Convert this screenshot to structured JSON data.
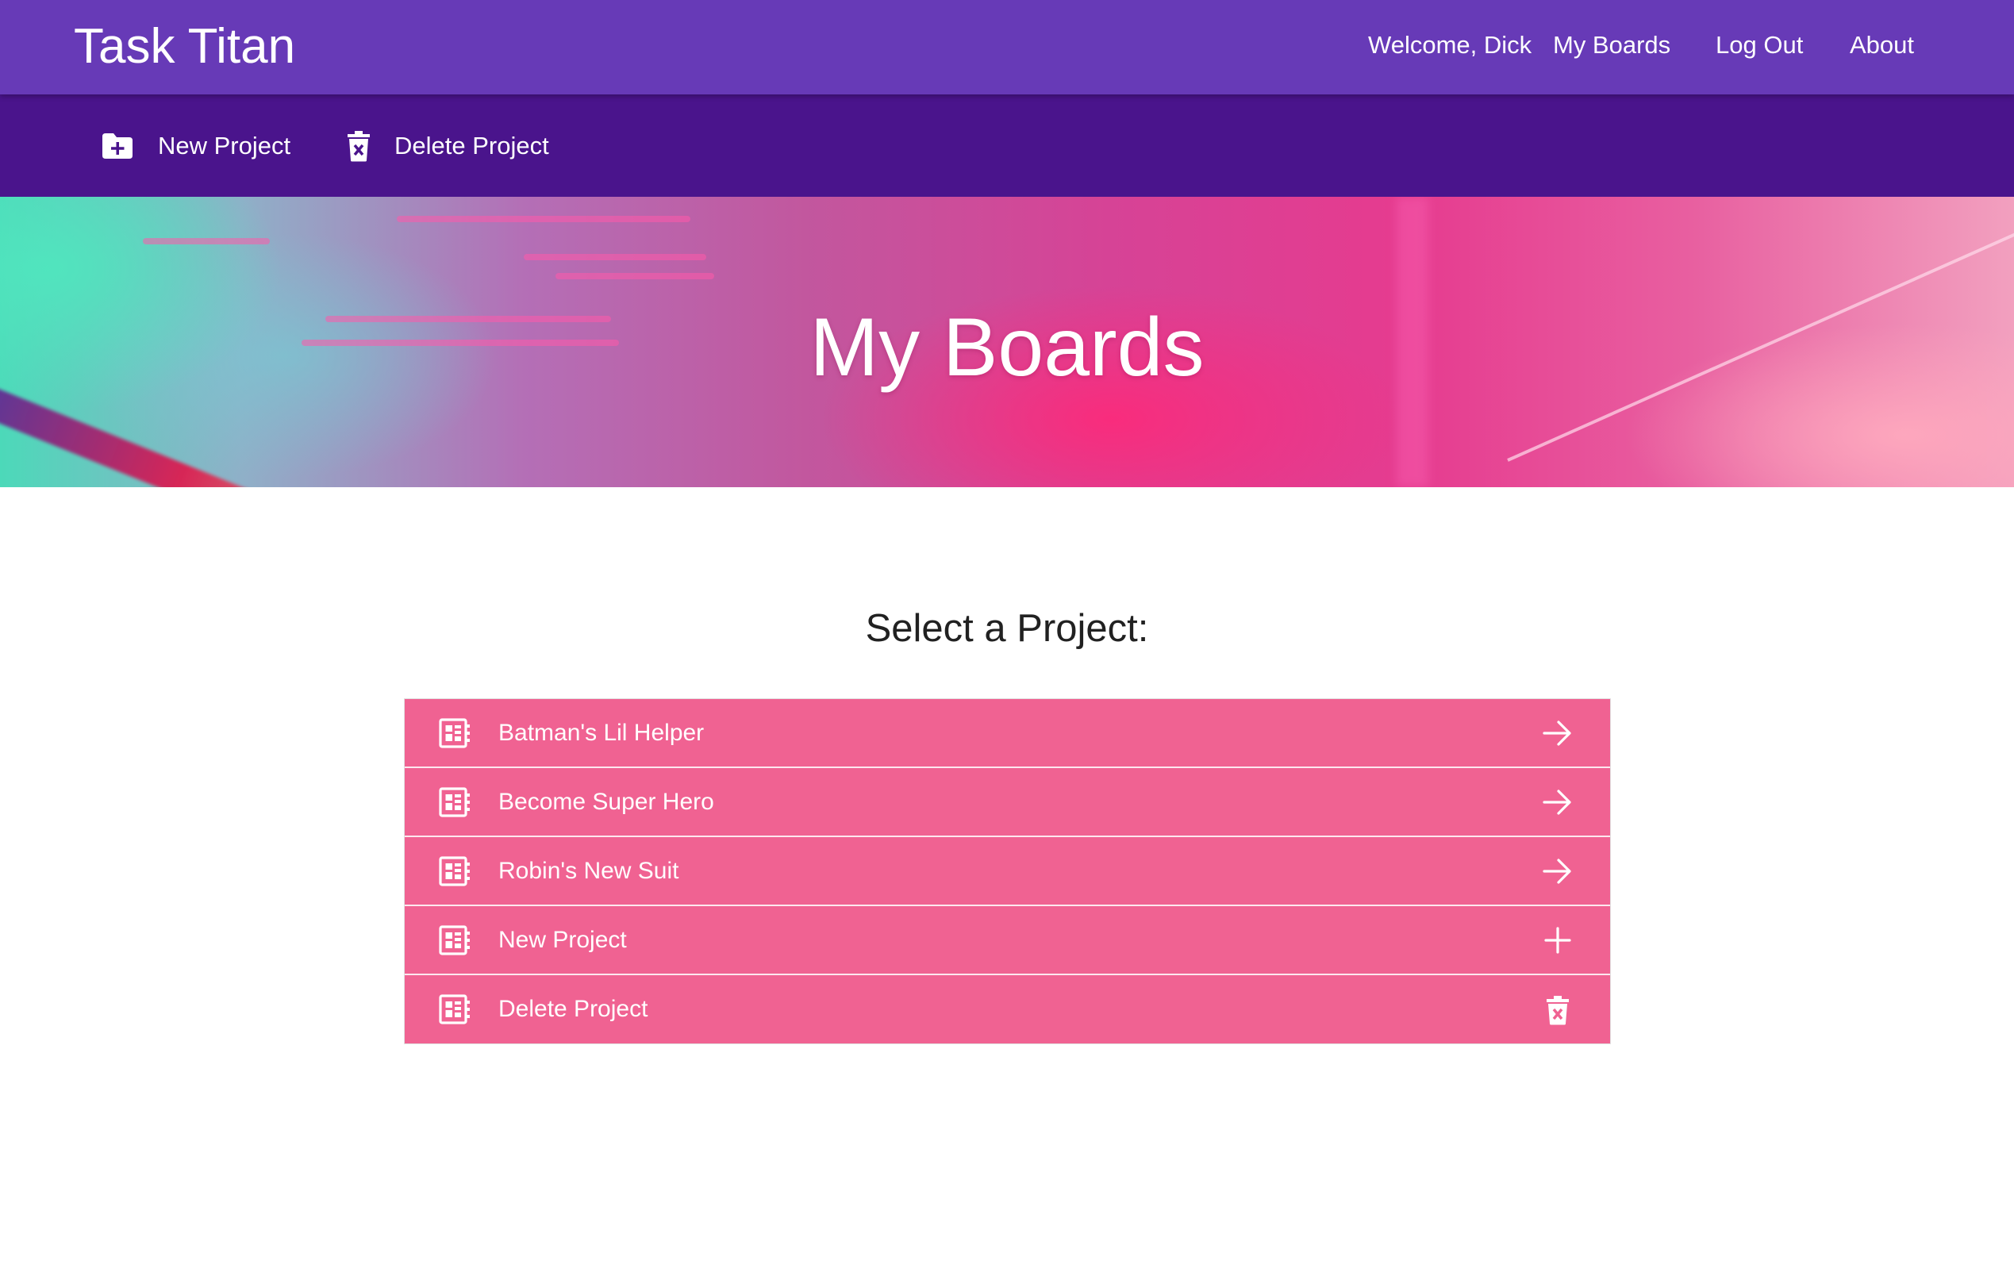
{
  "app": {
    "title": "Task Titan"
  },
  "nav": {
    "welcome": "Welcome, Dick",
    "my_boards": "My Boards",
    "logout": "Log Out",
    "about": "About"
  },
  "toolbar": {
    "new_project": {
      "label": "New Project",
      "icon": "folder-plus-icon"
    },
    "delete_project": {
      "label": "Delete Project",
      "icon": "trash-icon"
    }
  },
  "hero": {
    "title": "My Boards"
  },
  "main": {
    "prompt": "Select a Project:",
    "projects": [
      {
        "label": "Batman's Lil Helper",
        "icon": "board-icon",
        "action_icon": "arrow-right-icon"
      },
      {
        "label": "Become Super Hero",
        "icon": "board-icon",
        "action_icon": "arrow-right-icon"
      },
      {
        "label": "Robin's New Suit",
        "icon": "board-icon",
        "action_icon": "arrow-right-icon"
      },
      {
        "label": "New Project",
        "icon": "board-icon",
        "action_icon": "plus-icon"
      },
      {
        "label": "Delete Project",
        "icon": "board-icon",
        "action_icon": "trash-icon"
      }
    ]
  },
  "colors": {
    "topbar": "#673ab7",
    "subbar": "#4a148c",
    "list_item": "#f06292",
    "text_dark": "#212121"
  }
}
